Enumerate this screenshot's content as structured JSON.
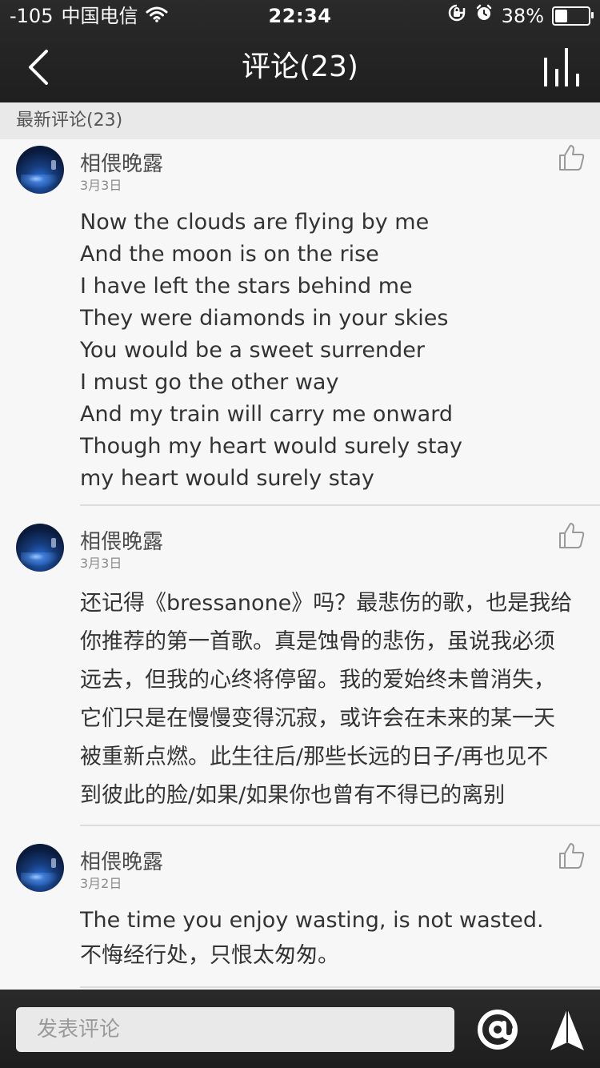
{
  "status": {
    "signal": "-105",
    "carrier": "中国电信",
    "time": "22:34",
    "battery_percent": "38%",
    "battery_level": 0.38
  },
  "nav": {
    "title": "评论(23)"
  },
  "section": {
    "title": "最新评论(23)"
  },
  "comments": [
    {
      "username": "相偎晚露",
      "date": "3月3日",
      "content": "Now the clouds are flying by me\nAnd the moon is on the rise\nI have left the stars behind me\nThey were diamonds in your skies\nYou would be a sweet surrender\nI must go the other way\nAnd my train will carry me onward\nThough my heart would surely stay\nmy heart would surely stay"
    },
    {
      "username": "相偎晚露",
      "date": "3月3日",
      "content": "还记得《bressanone》吗？最悲伤的歌，也是我给\n你推荐的第一首歌。真是蚀骨的悲伤，虽说我必须\n远去，但我的心终将停留。我的爱始终未曾消失，\n它们只是在慢慢变得沉寂，或许会在未来的某一天\n被重新点燃。此生往后/那些长远的日子/再也见不\n到彼此的脸/如果/如果你也曾有不得已的离别"
    },
    {
      "username": "相偎晚露",
      "date": "3月2日",
      "content": "The time you enjoy wasting, is not wasted.\n不悔经行处，只恨太匆匆。"
    }
  ],
  "input": {
    "placeholder": "发表评论"
  }
}
